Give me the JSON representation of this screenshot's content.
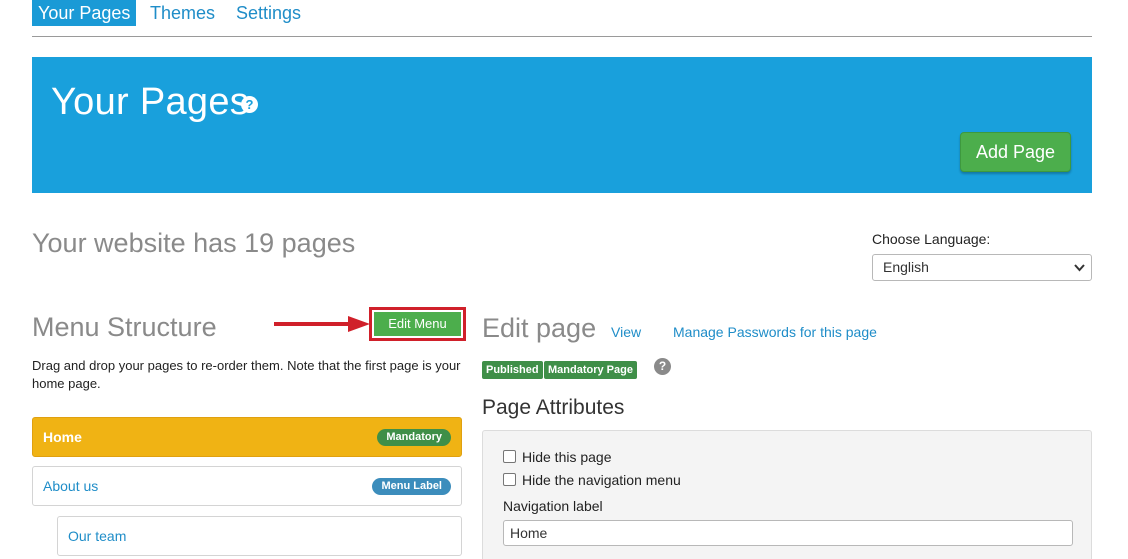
{
  "topnav": {
    "tabs": [
      {
        "label": "Your Pages",
        "active": true
      },
      {
        "label": "Themes",
        "active": false
      },
      {
        "label": "Settings",
        "active": false
      }
    ]
  },
  "hero": {
    "title": "Your Pages",
    "help_icon": "?",
    "add_page_label": "Add Page"
  },
  "summary": {
    "page_count_text": "Your website has 19 pages"
  },
  "language": {
    "label": "Choose Language:",
    "selected": "English"
  },
  "menu_structure": {
    "heading": "Menu Structure",
    "edit_menu_label": "Edit Menu",
    "description": "Drag and drop your pages to re-order them. Note that the first page is your home page.",
    "items": [
      {
        "label": "Home",
        "badge": "Mandatory",
        "selected": true
      },
      {
        "label": "About us",
        "badge": "Menu Label"
      },
      {
        "label": "Our team",
        "badge": ""
      }
    ]
  },
  "edit_page": {
    "heading": "Edit page",
    "view_link": "View",
    "passwords_link": "Manage Passwords for this page",
    "status_badges": [
      "Published",
      "Mandatory Page"
    ],
    "help_icon": "?",
    "attributes_heading": "Page Attributes",
    "hide_page_label": "Hide this page",
    "hide_nav_label": "Hide the navigation menu",
    "nav_label_caption": "Navigation label",
    "nav_label_value": "Home"
  },
  "colors": {
    "brand_blue": "#19a0dc",
    "link_blue": "#1f8dc8",
    "success_green": "#4cae4c",
    "home_yellow": "#f0b314",
    "highlight_red": "#d0202a"
  }
}
